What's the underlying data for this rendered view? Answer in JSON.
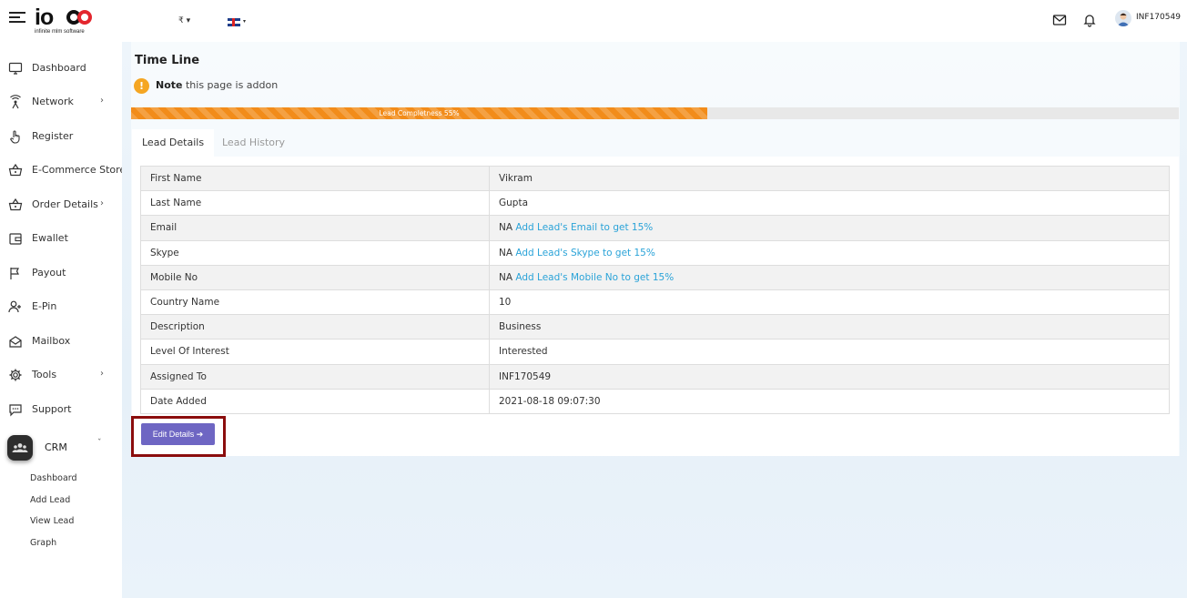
{
  "header": {
    "logo_main": "io",
    "logo_sub": "infinite mlm software",
    "currency": "₹ ▾",
    "language_caret": "▾",
    "username": "INF170549"
  },
  "sidebar": {
    "items": [
      {
        "label": "Dashboard",
        "icon": "monitor-icon"
      },
      {
        "label": "Network",
        "icon": "network-icon",
        "chevron": "›"
      },
      {
        "label": "Register",
        "icon": "hand-pointer-icon"
      },
      {
        "label": "E-Commerce Store",
        "icon": "basket-icon"
      },
      {
        "label": "Order Details",
        "icon": "basket-icon",
        "chevron": "›"
      },
      {
        "label": "Ewallet",
        "icon": "wallet-icon"
      },
      {
        "label": "Payout",
        "icon": "flag-icon"
      },
      {
        "label": "E-Pin",
        "icon": "user-plus-icon"
      },
      {
        "label": "Mailbox",
        "icon": "envelope-open-icon"
      },
      {
        "label": "Tools",
        "icon": "gear-icon",
        "chevron": "›"
      },
      {
        "label": "Support",
        "icon": "chat-icon"
      }
    ],
    "crm": {
      "label": "CRM",
      "chevron": "ˇ"
    },
    "crm_sub": [
      "Dashboard",
      "Add Lead",
      "View Lead",
      "Graph"
    ]
  },
  "main": {
    "title": "Time Line",
    "note_bold": "Note",
    "note_text": " this page is addon",
    "progress": {
      "label": "Lead Completness 55%",
      "percent": 55
    },
    "tabs": [
      "Lead Details",
      "Lead History"
    ],
    "details": [
      {
        "key": "First Name",
        "value": "Vikram"
      },
      {
        "key": "Last Name",
        "value": "Gupta"
      },
      {
        "key": "Email",
        "value": "NA",
        "link": "Add Lead's Email to get 15%"
      },
      {
        "key": "Skype",
        "value": "NA",
        "link": "Add Lead's Skype to get 15%"
      },
      {
        "key": "Mobile No",
        "value": "NA",
        "link": "Add Lead's Mobile No to get 15%"
      },
      {
        "key": "Country Name",
        "value": "10"
      },
      {
        "key": "Description",
        "value": "Business"
      },
      {
        "key": "Level Of Interest",
        "value": "Interested"
      },
      {
        "key": "Assigned To",
        "value": "INF170549"
      },
      {
        "key": "Date Added",
        "value": "2021-08-18 09:07:30"
      }
    ],
    "edit_button": "Edit Details ➔"
  },
  "colors": {
    "accent": "#6e66c3",
    "progress": "#f28c1a",
    "link": "#2aa3d8",
    "highlight": "#8b0d0d",
    "note": "#f5a623"
  }
}
